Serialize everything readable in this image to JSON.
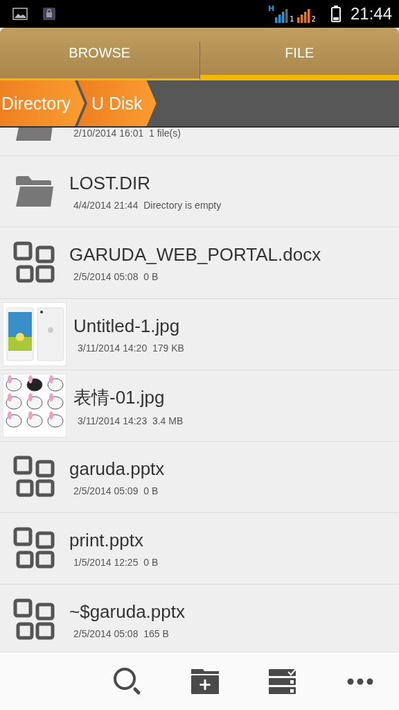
{
  "status_bar": {
    "network": "H",
    "sim_1": "1",
    "sim_2": "2",
    "time": "21:44"
  },
  "tabs": [
    {
      "label": "BROWSE",
      "selected": false
    },
    {
      "label": "FILE",
      "selected": true
    }
  ],
  "breadcrumb": [
    "Directory",
    "U Disk"
  ],
  "files": [
    {
      "kind": "folder",
      "meta": "2/10/2014 16:01  1 file(s)"
    },
    {
      "kind": "folder",
      "name": "LOST.DIR",
      "meta": "4/4/2014 21:44  Directory is empty"
    },
    {
      "kind": "document",
      "name": "GARUDA_WEB_PORTAL.docx",
      "meta": "2/5/2014 05:08  0 B"
    },
    {
      "kind": "phone-image",
      "name": "Untitled-1.jpg",
      "meta": "3/11/2014 14:20  179 KB"
    },
    {
      "kind": "sticker-image",
      "name": "表情-01.jpg",
      "meta": "3/11/2014 14:23  3.4 MB"
    },
    {
      "kind": "document",
      "name": "garuda.pptx",
      "meta": "2/5/2014 05:09  0 B"
    },
    {
      "kind": "document",
      "name": "print.pptx",
      "meta": "1/5/2014 12:25  0 B"
    },
    {
      "kind": "document",
      "name": "~$garuda.pptx",
      "meta": "2/5/2014 05:08  165 B"
    }
  ],
  "toolbar": [
    {
      "kind": "search"
    },
    {
      "kind": "new-folder"
    },
    {
      "kind": "select"
    },
    {
      "kind": "more"
    }
  ]
}
